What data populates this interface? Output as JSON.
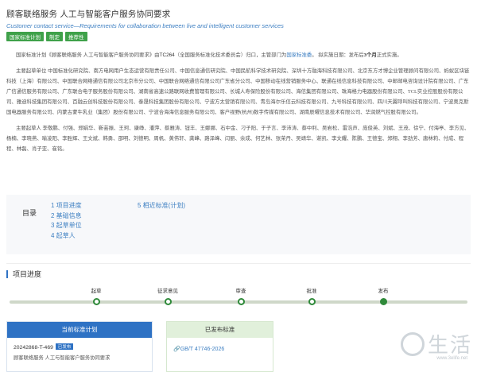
{
  "header": {
    "title": "顾客联络服务 人工与智能客户服务协同要求",
    "title_en": "Customer contact service—Requirements for collaboration between live and intelligent customer services",
    "tags": [
      "国家标准计划",
      "制定",
      "推荐性"
    ]
  },
  "summary": {
    "p1_a": "国家标准计划《顾客联络服务 人工与智能客户服务协同要求》由",
    "tc_code": "TC264",
    "p1_b": "（全国服务标准化技术委员会）归口，主管部门为",
    "dept": "国家标准委",
    "p1_c": "。 拟实施日期：发布后",
    "months": "3个月",
    "p1_d": "正式实施。",
    "p2": "主要起草单位 中国标准化研究院、南方电网用户生态运营有限责任公司、中国信息通信研究院、中国民航科学技术研究院、深圳十方融海科技有限公司、北京东方才博企业管理顾问有限公司、蚂蚁区块链科技（上海）有限公司、中国联合网络通信有限公司北京市分公司、中国联合网络通信有限公司广东省分公司、中国移动在线营销服务中心、联通在线信息科技有限公司、中邮邮电咨询设计院有限公司、广东广信通信服务有限公司、广东联合电子服务股份有限公司、湖南省高速公路联网收费管理有限公司、长城人寿保险股份有限公司、海信集团有限公司、珠海格力电器股份有限公司、TCL实业控股股份有限公司、雅迪科技集团有限公司、百融云创科技股份有限公司、泰晟科技集团股份有限公司、宁波方太营销有限公司、青岛海尔乐信云科技有限公司、九号科技有限公司、四川天翼呼叫科技有限公司、宁波奥克斯国电器服务有限公司、内蒙古蒙牛乳业（集团）股份有限公司、宁波合海海信息服务有限公司、客户视野(杭州)数字传媒有限公司、湖南辰曜信息技术有限公司、华润燃气控股有限公司。",
    "p3": "主要起草人 李敬鹏、付强、郑娟华、靳芸振、王珂、康峥、潘萍、蔡雅涛、钮丰、王娜娜、石中金、刁子阳、于子言、李沛涛、蔡中利、吴岩松、雷浩声、庞俊英、刘斌、王茂、徐宁、付海亭、李方见、杨楠、李晓燕、喻凌阳、李胜辉、王文斌、韩勇、邵明、刘德明、周帆、黄伟轩、龚峰、路泽峰、闫丽、余成、何艺林、张荣丹、吴靖华、谌凯、李文耀、陈鹏、王德宝、郑翔、李劲芳、唐林莉、付成、程程、林磊、肖子亚、崔铭。"
  },
  "toc": {
    "title": "目录",
    "items_left": [
      "1  项目进度",
      "2  基础信息",
      "3  起草单位",
      "4  起草人"
    ],
    "items_right": [
      "5  相近标准(计划)"
    ]
  },
  "progress": {
    "section_title": "项目进度",
    "stages": [
      "起草",
      "征求意见",
      "审查",
      "批准",
      "发布"
    ],
    "completed_stages": 5
  },
  "current_plan": {
    "head": "当前标准计划",
    "plan_no": "20242868-T-469",
    "badge": "已发布",
    "name": "顾客联络服务 人工与智能客户服务协同要求"
  },
  "published": {
    "head": "已发布标准",
    "std_no": "GB/T 47746-2026"
  },
  "watermark": {
    "text": "生活",
    "url": "www.3elife.net"
  },
  "colors": {
    "accent_blue": "#2e72c4",
    "tag_green": "#3fa14a",
    "progress_green": "#2f8a3a",
    "link_blue": "#3d7fc2"
  }
}
